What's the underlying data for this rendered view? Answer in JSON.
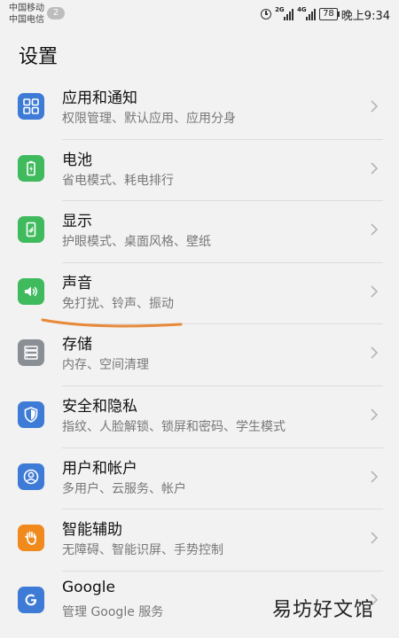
{
  "status_bar": {
    "carrier_1": "中国移动",
    "carrier_2": "中国电信",
    "notification_count": "2",
    "network_1": "2G",
    "network_2": "4G",
    "battery": "78",
    "time": "晚上9:34"
  },
  "header": {
    "title": "设置"
  },
  "items": [
    {
      "title": "应用和通知",
      "subtitle": "权限管理、默认应用、应用分身",
      "icon": "apps-grid-icon",
      "color": "#3e7bd6"
    },
    {
      "title": "电池",
      "subtitle": "省电模式、耗电排行",
      "icon": "battery-icon",
      "color": "#3fba5d"
    },
    {
      "title": "显示",
      "subtitle": "护眼模式、桌面风格、壁纸",
      "icon": "display-icon",
      "color": "#3fba5d"
    },
    {
      "title": "声音",
      "subtitle": "免打扰、铃声、振动",
      "icon": "speaker-icon",
      "color": "#3fba5d"
    },
    {
      "title": "存储",
      "subtitle": "内存、空间清理",
      "icon": "storage-icon",
      "color": "#8a8f95"
    },
    {
      "title": "安全和隐私",
      "subtitle": "指纹、人脸解锁、锁屏和密码、学生模式",
      "icon": "shield-icon",
      "color": "#3e7bd6"
    },
    {
      "title": "用户和帐户",
      "subtitle": "多用户、云服务、帐户",
      "icon": "user-icon",
      "color": "#3e7bd6"
    },
    {
      "title": "智能辅助",
      "subtitle": "无障碍、智能识屏、手势控制",
      "icon": "hand-icon",
      "color": "#f08a1d"
    },
    {
      "title": "Google",
      "subtitle": "管理 Google 服务",
      "icon": "google-icon",
      "color": "#3e7bd6"
    }
  ],
  "annotation": {
    "color": "#e8893a"
  },
  "watermark": "易坊好文馆"
}
